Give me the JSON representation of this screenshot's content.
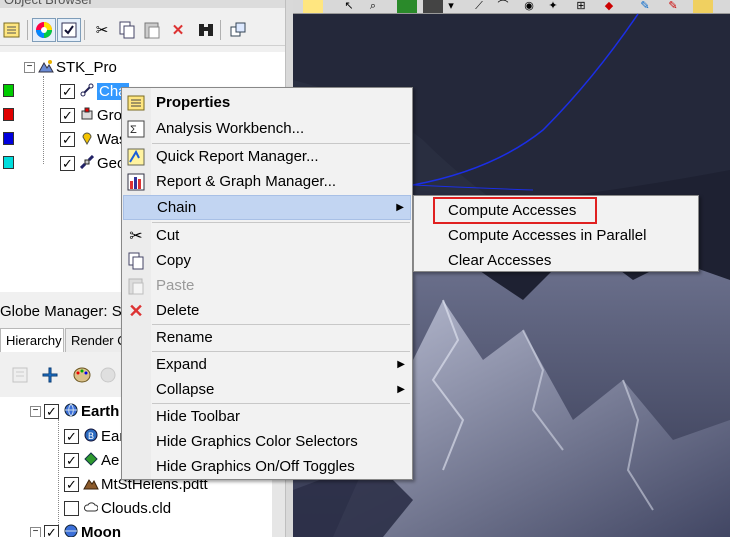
{
  "object_browser": {
    "title": "Object Browser",
    "toolbar_icons": [
      "new-icon",
      "color-wheel-icon",
      "checkbox-icon",
      "cut-icon",
      "copy-icon",
      "paste-icon",
      "delete-icon",
      "binoculars-icon",
      "windows-icon"
    ],
    "tree": {
      "root": "STK_Pro",
      "children": [
        {
          "label": "Cha",
          "color": "#00cc00",
          "icon": "chain-icon",
          "checked": true,
          "selected": true
        },
        {
          "label": "Gro",
          "color": "#e00000",
          "icon": "ground-icon",
          "checked": true
        },
        {
          "label": "Was",
          "color": "#0000dd",
          "icon": "place-icon",
          "checked": true
        },
        {
          "label": "Geo",
          "color": "#00dddd",
          "icon": "satellite-icon",
          "checked": true
        }
      ]
    }
  },
  "globe_manager": {
    "title": "Globe Manager: S",
    "tabs": [
      "Hierarchy",
      "Render O"
    ],
    "tree": [
      {
        "label": "Earth",
        "bold": true,
        "checked": true,
        "icon": "globe-icon",
        "expanded": true
      },
      {
        "label": "Ear",
        "checked": true,
        "icon": "earth-layer-icon"
      },
      {
        "label": "Ae",
        "checked": true,
        "icon": "terrain-icon"
      },
      {
        "label": "MtStHelens.pdtt",
        "checked": true,
        "icon": "mountain-icon"
      },
      {
        "label": "Clouds.cld",
        "checked": false,
        "icon": "cloud-icon"
      },
      {
        "label": "Moon",
        "bold": true,
        "checked": true,
        "icon": "globe-icon",
        "expanded": true
      }
    ]
  },
  "context_menu": {
    "items": [
      {
        "label": "Properties",
        "icon": "properties-icon",
        "bold": true
      },
      {
        "label": "Analysis Workbench...",
        "icon": "workbench-icon"
      },
      {
        "sep": true
      },
      {
        "label": "Quick Report Manager...",
        "icon": "report-icon"
      },
      {
        "label": "Report & Graph Manager...",
        "icon": "graph-icon"
      },
      {
        "label": "Chain",
        "arrow": true,
        "highlighted": true
      },
      {
        "sep": true
      },
      {
        "label": "Cut",
        "icon": "cut-icon"
      },
      {
        "label": "Copy",
        "icon": "copy-icon"
      },
      {
        "label": "Paste",
        "icon": "paste-icon",
        "disabled": true
      },
      {
        "label": "Delete",
        "icon": "delete-icon"
      },
      {
        "sep": true
      },
      {
        "label": "Rename"
      },
      {
        "sep": true
      },
      {
        "label": "Expand",
        "arrow": true
      },
      {
        "label": "Collapse",
        "arrow": true
      },
      {
        "sep": true
      },
      {
        "label": "Hide Toolbar"
      },
      {
        "label": "Hide Graphics Color Selectors"
      },
      {
        "label": "Hide Graphics On/Off Toggles"
      }
    ]
  },
  "submenu": {
    "items": [
      "Compute Accesses",
      "Compute Accesses in Parallel",
      "Clear Accesses"
    ]
  }
}
